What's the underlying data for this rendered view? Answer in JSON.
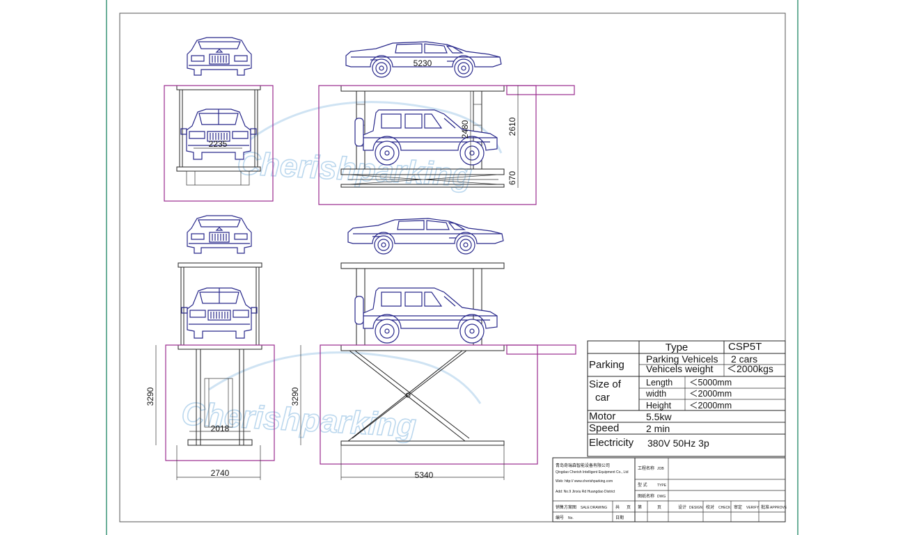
{
  "dimensions": {
    "top_side_length": "5230",
    "top_front_width": "2235",
    "top_clearance": "2480",
    "top_total_height": "2610",
    "pit_depth": "670",
    "front_height": "3290",
    "side_height": "3290",
    "inner_width": "2018",
    "front_width": "2740",
    "side_length": "5340"
  },
  "watermark": "Cherishparking",
  "spec_table": {
    "type_label": "Type",
    "type_value": "CSP5T",
    "parking_label": "Parking",
    "parking_rows": [
      {
        "label": "Parking Vehicels",
        "value": "2 cars"
      },
      {
        "label": "Vehicels weight",
        "value": "＜2000kgs"
      }
    ],
    "size_label_1": "Size  of",
    "size_label_2": "car",
    "size_rows": [
      {
        "label": "Length",
        "value": "＜5000mm"
      },
      {
        "label": "width",
        "value": "＜2000mm"
      },
      {
        "label": "Height",
        "value": "＜2000mm"
      }
    ],
    "motor_label": "Motor",
    "motor_value": "5.5kw",
    "speed_label": "Speed",
    "speed_value": "2 min",
    "electricity_label": "Electricity",
    "electricity_value": "380V  50Hz  3p"
  },
  "title_block": {
    "company_cn": "青岛奇瑞森智能设备有限公司",
    "company_en": "Qingdao Cherish Intelligent Equipment Co., Ltd",
    "web": "Web: http:// www.cherishparking.com",
    "address": "Add: No.9 Jinxiu Rd Huangdao District",
    "job_cn": "工程名称",
    "job_en": "JOB",
    "type_cn": "型    式",
    "type_en": "TYPE",
    "dwg_cn": "图纸名称",
    "dwg_en": "DWG",
    "sale_cn": "销售方案图",
    "sale_en": "SALE DRAWING",
    "total_cn": "共",
    "page_cn": "页",
    "sheet_cn": "第",
    "page2_cn": "页",
    "design_cn": "设计",
    "design_en": "DESIGN",
    "check_cn": "校对",
    "check_en": "CHECK",
    "verify_cn": "审定",
    "verify_en": "VERIFY",
    "approve_cn": "批准",
    "approve_en": "APPROVE",
    "no_cn": "编号",
    "no_en": "No.",
    "date_cn": "日期"
  },
  "colors": {
    "car_line": "#27278a",
    "pit_line": "#9a2a8e",
    "watermark": "#bcd8ee",
    "frame": "#2f8f6f"
  }
}
